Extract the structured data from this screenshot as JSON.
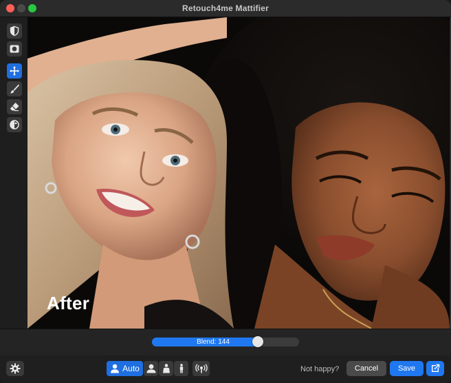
{
  "window": {
    "title": "Retouch4me Mattifier"
  },
  "toolbar": {
    "tools": [
      {
        "icon": "shield-icon",
        "active": false
      },
      {
        "icon": "mask-icon",
        "active": false
      },
      {
        "icon": "move-icon",
        "active": true
      },
      {
        "icon": "brush-icon",
        "active": false
      },
      {
        "icon": "eraser-icon",
        "active": false
      },
      {
        "icon": "contrast-icon",
        "active": false
      }
    ]
  },
  "viewer": {
    "mode_label": "After"
  },
  "blend": {
    "label": "Blend: 144",
    "value": 144,
    "max": 200
  },
  "bottom": {
    "settings_icon": "gear-icon",
    "mode_auto_label": "Auto",
    "modes": [
      "person-auto-icon",
      "face-icon",
      "half-body-icon",
      "full-body-icon"
    ],
    "broadcast_icon": "broadcast-icon",
    "not_happy": "Not happy?",
    "cancel_label": "Cancel",
    "save_label": "Save",
    "export_icon": "export-icon"
  },
  "colors": {
    "accent": "#1f6fe0",
    "close": "#ff5f57",
    "maximize": "#28c840"
  }
}
